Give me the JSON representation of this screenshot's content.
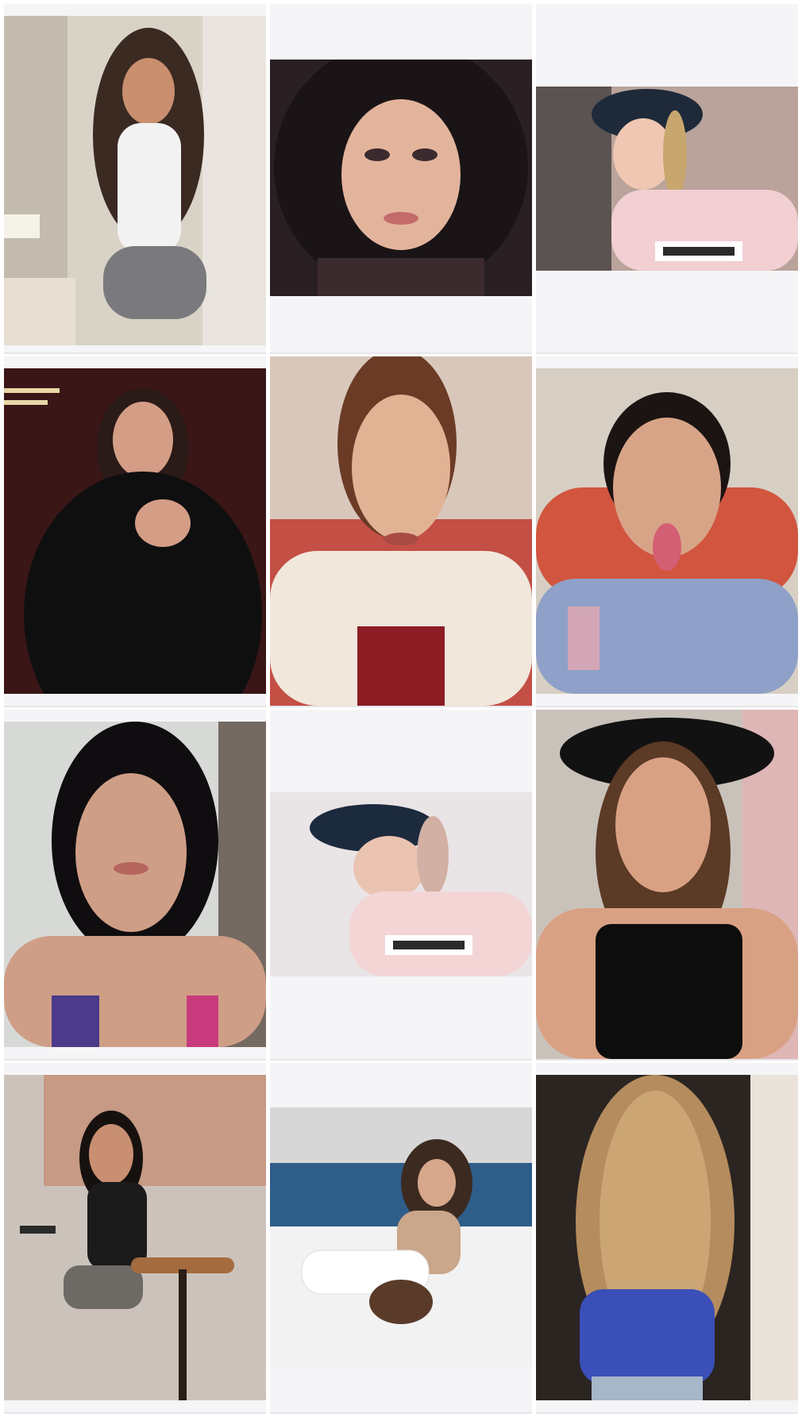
{
  "gallery": {
    "tiles": [
      {
        "id": "tile-1",
        "subject": "woman-white-tank-grey-skirt",
        "palette": {
          "bg": "#d9d3c7",
          "accent": "#3a2a22",
          "skin": "#c98f6e",
          "cloth": "#f2f2f2",
          "cloth2": "#7a7a7e"
        }
      },
      {
        "id": "tile-2",
        "subject": "selfie-dark-hair",
        "palette": {
          "bg": "#2a2024",
          "accent": "#1a1416",
          "skin": "#e3b49c",
          "cloth": "#3b2a2e",
          "cloth2": "#bfa39a"
        }
      },
      {
        "id": "tile-3",
        "subject": "bucket-hat-pink-sweater",
        "palette": {
          "bg": "#b9a39a",
          "accent": "#1e2a3a",
          "skin": "#efc7b2",
          "cloth": "#f2cfd3",
          "cloth2": "#2b2b2b"
        }
      },
      {
        "id": "tile-4",
        "subject": "black-outfit-fur-coat",
        "palette": {
          "bg": "#3a1616",
          "accent": "#2a1a18",
          "skin": "#d49d85",
          "cloth": "#0f0f10",
          "cloth2": "#4b1d1d"
        }
      },
      {
        "id": "tile-5",
        "subject": "white-blazer-red-top",
        "palette": {
          "bg": "#d9c7bb",
          "accent": "#6b3b25",
          "skin": "#e2b295",
          "cloth": "#f1e7dc",
          "cloth2": "#8d1c24"
        }
      },
      {
        "id": "tile-6",
        "subject": "satin-pajama-tongue-out",
        "palette": {
          "bg": "#d8cfc4",
          "accent": "#1c1412",
          "skin": "#d8a487",
          "cloth": "#8fa1c8",
          "cloth2": "#d1553f"
        }
      },
      {
        "id": "tile-7",
        "subject": "headband-swimsuit",
        "palette": {
          "bg": "#d7d9d6",
          "accent": "#0f0d0f",
          "skin": "#cf9e86",
          "cloth": "#4c3b8a",
          "cloth2": "#c83c7d"
        }
      },
      {
        "id": "tile-8",
        "subject": "bucket-hat-pink-sweater-tilted",
        "palette": {
          "bg": "#e9e4e6",
          "accent": "#1c2a3e",
          "skin": "#eac3b1",
          "cloth": "#f3d5d6",
          "cloth2": "#2b2b2b"
        }
      },
      {
        "id": "tile-9",
        "subject": "black-hat-black-top",
        "palette": {
          "bg": "#c9c2ba",
          "accent": "#5b3a26",
          "skin": "#d9a183",
          "cloth": "#121212",
          "cloth2": "#0d0d0d"
        }
      },
      {
        "id": "tile-10",
        "subject": "cafe-black-top-denim-shorts",
        "palette": {
          "bg": "#cbc3bb",
          "accent": "#16110f",
          "skin": "#c88f72",
          "cloth": "#1b1b1b",
          "cloth2": "#6d6a66"
        }
      },
      {
        "id": "tile-11",
        "subject": "bed-pose-handbag",
        "palette": {
          "bg": "#d8d7d7",
          "accent": "#3c2a20",
          "skin": "#d7a78b",
          "cloth": "#f2f2f2",
          "cloth2": "#2f5d8a"
        }
      },
      {
        "id": "tile-12",
        "subject": "long-wavy-hair-back",
        "palette": {
          "bg": "#2b2522",
          "accent": "#b58c5e",
          "skin": "#d3a58a",
          "cloth": "#3a4fb8",
          "cloth2": "#a7b6c9"
        }
      }
    ]
  }
}
